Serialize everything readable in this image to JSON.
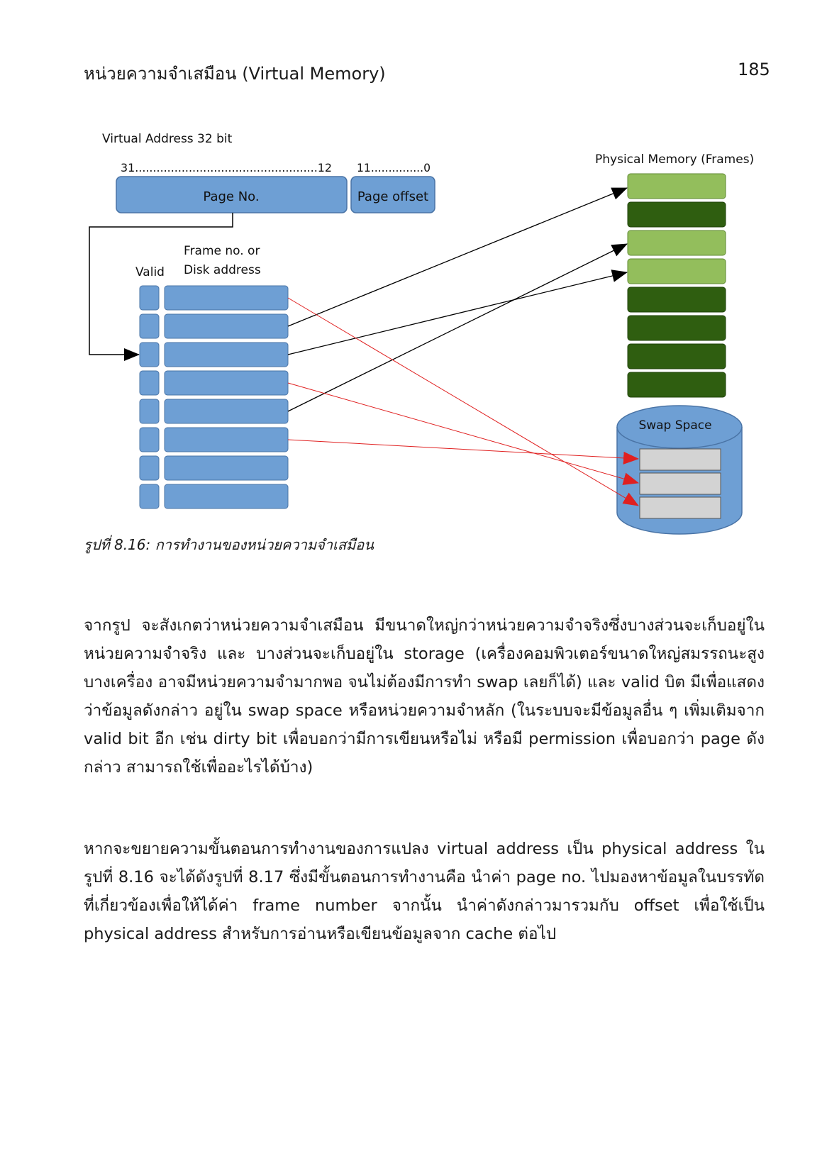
{
  "header": {
    "title": "หน่วยความจำเสมือน (Virtual Memory)",
    "page_number": "185"
  },
  "figure": {
    "virtual_address_label": "Virtual Address 32 bit",
    "page_no_bits": "31...................................................12",
    "offset_bits": "11...............0",
    "page_no_label": "Page No.",
    "page_offset_label": "Page offset",
    "frame_label_line1": "Frame no. or",
    "frame_label_line2": "Disk address",
    "valid_label": "Valid",
    "physical_memory_label": "Physical Memory (Frames)",
    "swap_space_label": "Swap Space",
    "colors": {
      "table_blue": "#6e9fd4",
      "frame_light_green": "#93be5c",
      "frame_dark_green": "#2f5e10",
      "swap_grey": "#d3d3d3",
      "arrow_red": "#e02020"
    }
  },
  "caption": "รูปที่ 8.16: การทำงานของหน่วยความจำเสมือน",
  "paragraphs": [
    "จากรูป จะสังเกตว่าหน่วยความจำเสมือน มีขนาดใหญ่กว่าหน่วยความจำจริงซึ่งบางส่วนจะเก็บอยู่ในหน่วยความจำจริง และ บางส่วนจะเก็บอยู่ใน storage (เครื่องคอมพิวเตอร์ขนาดใหญ่สมรรถนะสูงบางเครื่อง อาจมีหน่วยความจำมากพอ จนไม่ต้องมีการทำ swap เลยก็ได้) และ valid บิต มีเพื่อแสดงว่าข้อมูลดังกล่าว อยู่ใน swap space หรือหน่วยความจำหลัก (ในระบบจะมีข้อมูลอื่น ๆ เพิ่มเติมจาก valid bit อีก เช่น dirty bit เพื่อบอกว่ามีการเขียนหรือไม่ หรือมี permission เพื่อบอกว่า page ดังกล่าว สามารถใช้เพื่ออะไรได้บ้าง)",
    "หากจะขยายความขั้นตอนการทำงานของการแปลง virtual address เป็น physical address ใน รูปที่ 8.16 จะได้ดังรูปที่ 8.17 ซึ่งมีขั้นตอนการทำงานคือ นำค่า page no. ไปมองหาข้อมูลในบรรทัดที่เกี่ยวข้องเพื่อให้ได้ค่า frame number จากนั้น นำค่าดังกล่าวมารวมกับ offset เพื่อใช้เป็น physical address สำหรับการอ่านหรือเขียนข้อมูลจาก cache ต่อไป"
  ]
}
